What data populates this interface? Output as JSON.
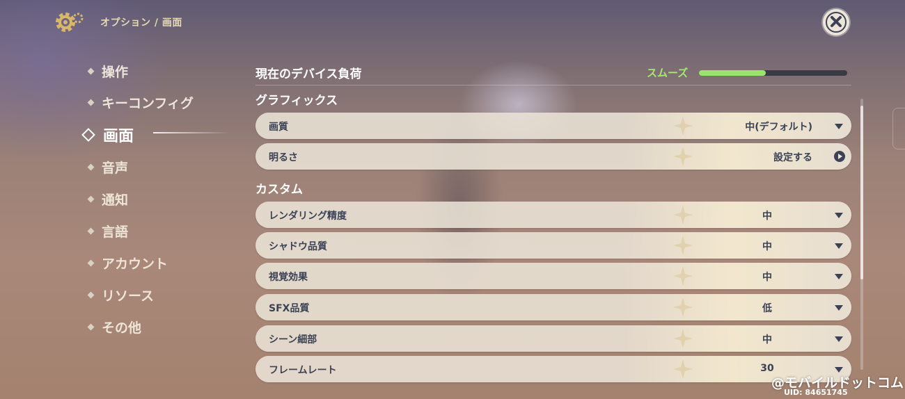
{
  "header": {
    "breadcrumb": "オプション / 画面",
    "settings_icon": "gear-icon",
    "close_icon": "close-icon"
  },
  "nav": {
    "items": [
      {
        "label": "操作",
        "active": false
      },
      {
        "label": "キーコンフィグ",
        "active": false
      },
      {
        "label": "画面",
        "active": true
      },
      {
        "label": "音声",
        "active": false
      },
      {
        "label": "通知",
        "active": false
      },
      {
        "label": "言語",
        "active": false
      },
      {
        "label": "アカウント",
        "active": false
      },
      {
        "label": "リソース",
        "active": false
      },
      {
        "label": "その他",
        "active": false
      }
    ]
  },
  "device_load": {
    "title": "現在のデバイス負荷",
    "status": "スムーズ",
    "level": 0.45,
    "status_color": "#a6e873"
  },
  "graphics": {
    "title": "グラフィックス",
    "rows": [
      {
        "label": "画質",
        "value": "中(デフォルト)",
        "control": "dropdown"
      },
      {
        "label": "明るさ",
        "value": "設定する",
        "control": "button"
      }
    ]
  },
  "custom": {
    "title": "カスタム",
    "rows": [
      {
        "label": "レンダリング精度",
        "value": "中",
        "control": "dropdown"
      },
      {
        "label": "シャドウ品質",
        "value": "中",
        "control": "dropdown"
      },
      {
        "label": "視覚効果",
        "value": "中",
        "control": "dropdown"
      },
      {
        "label": "SFX品質",
        "value": "低",
        "control": "dropdown"
      },
      {
        "label": "シーン細部",
        "value": "中",
        "control": "dropdown"
      },
      {
        "label": "フレームレート",
        "value": "30",
        "control": "dropdown"
      }
    ]
  },
  "footer": {
    "uid": "UID: 84651745",
    "watermark": "@モバイルドットコム"
  }
}
